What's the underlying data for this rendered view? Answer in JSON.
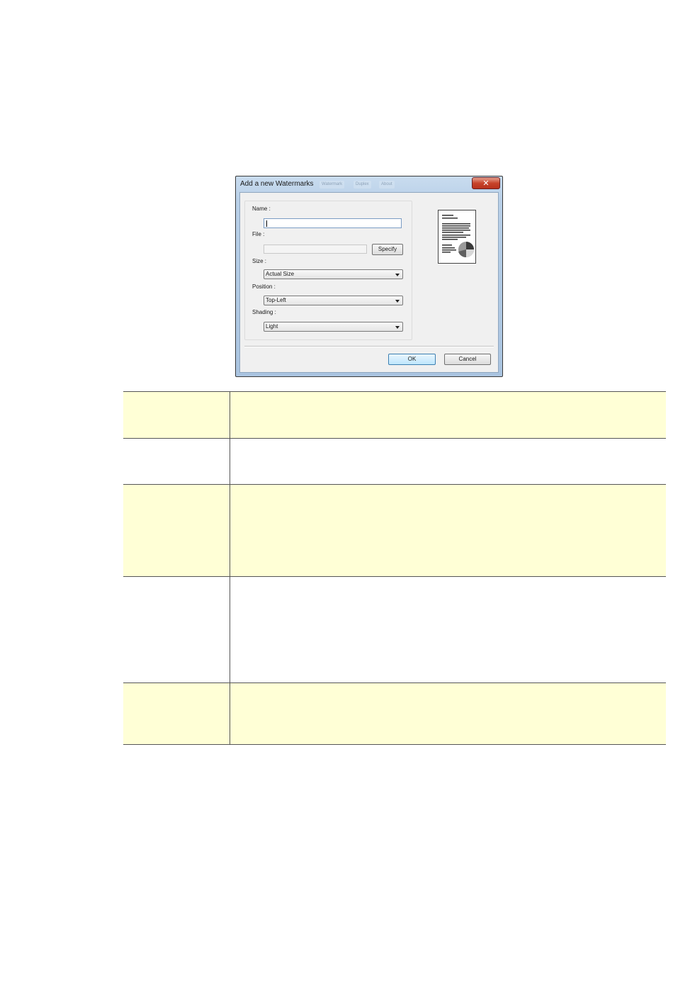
{
  "dialog": {
    "title": "Add a new Watermarks",
    "ghost_tabs": [
      "Watermark",
      "Duplex",
      "About"
    ],
    "close_label": "✕",
    "name": {
      "label": "Name :",
      "value": ""
    },
    "file": {
      "label": "File :",
      "value": "",
      "specify_label": "Specify"
    },
    "size": {
      "label": "Size :",
      "selected": "Actual Size"
    },
    "position": {
      "label": "Position :",
      "selected": "Top-Left"
    },
    "shading": {
      "label": "Shading :",
      "selected": "Light"
    },
    "ok_label": "OK",
    "cancel_label": "Cancel",
    "preview_icon": "document-preview-with-pie-icon"
  },
  "table": {
    "rows": [
      {
        "name": "",
        "description": "",
        "highlight": true
      },
      {
        "name": "",
        "description": "",
        "highlight": false
      },
      {
        "name": "",
        "description": "",
        "highlight": true
      },
      {
        "name": "",
        "description": "",
        "highlight": false
      },
      {
        "name": "",
        "description": "",
        "highlight": true
      }
    ],
    "highlight_color": "#ffffd6"
  }
}
